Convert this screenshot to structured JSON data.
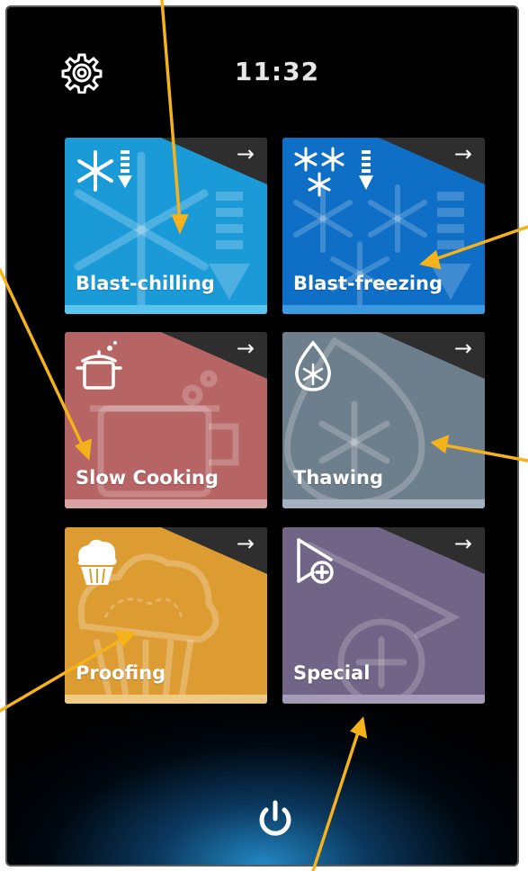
{
  "status": {
    "time": "11:32"
  },
  "icons": {
    "settings": "gear-icon",
    "power": "power-icon"
  },
  "tiles": [
    {
      "label": "Blast-chilling",
      "arrow": "→",
      "color": "#1b9ad8",
      "bar": "#59c4ee"
    },
    {
      "label": "Blast-freezing",
      "arrow": "→",
      "color": "#0f6fc6",
      "bar": "#3b9ae0"
    },
    {
      "label": "Slow Cooking",
      "arrow": "→",
      "color": "#b76464",
      "bar": "#d9a3a3"
    },
    {
      "label": "Thawing",
      "arrow": "→",
      "color": "#6d7e8d",
      "bar": "#a4b2bf"
    },
    {
      "label": "Proofing",
      "arrow": "→",
      "color": "#dc9c32",
      "bar": "#efcb86"
    },
    {
      "label": "Special",
      "arrow": "→",
      "color": "#716587",
      "bar": "#a79dbb"
    }
  ],
  "annotation_color": "#f5b21b"
}
